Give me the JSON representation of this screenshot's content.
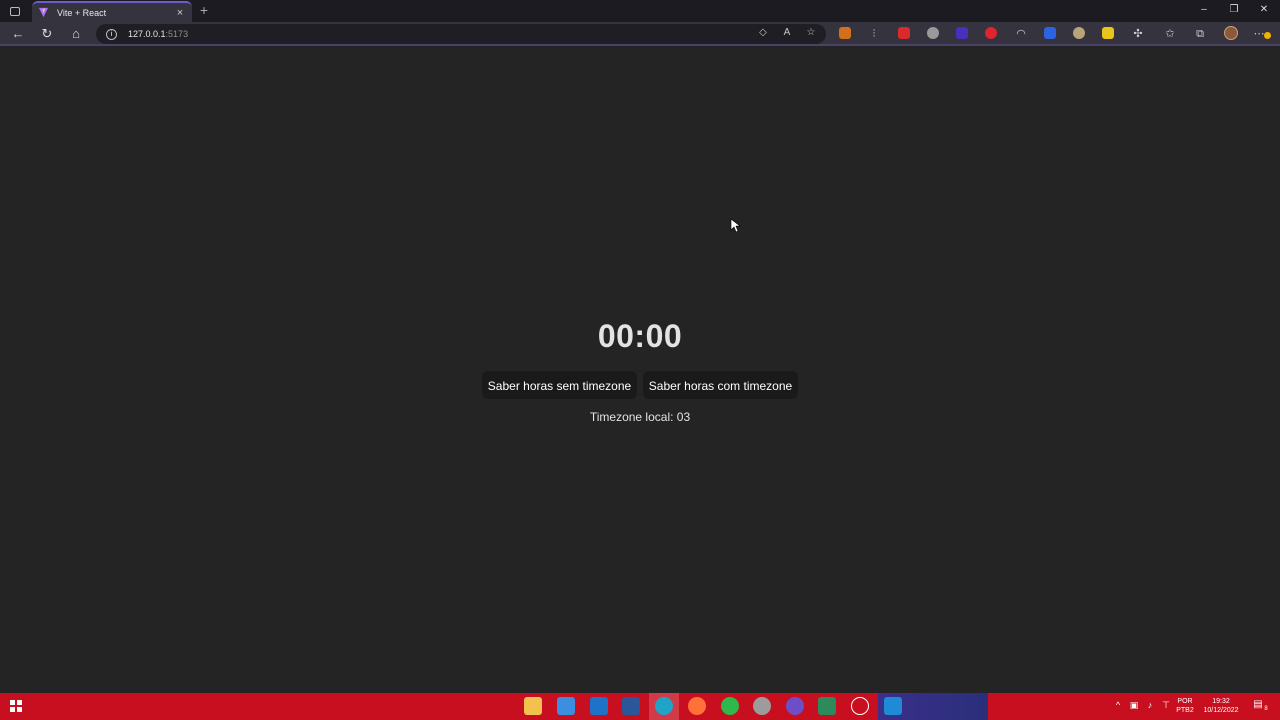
{
  "browser": {
    "tab_title": "Vite + React",
    "tab_close": "×",
    "new_tab": "+",
    "url_host": "127.0.0.1",
    "url_port": ":5173",
    "window_controls": {
      "minimize": "–",
      "restore": "❐",
      "close": "✕"
    }
  },
  "app": {
    "clock": "00:00",
    "button_without_tz": "Saber horas sem timezone",
    "button_with_tz": "Saber horas com timezone",
    "timezone_text": "Timezone local: 03"
  },
  "taskbar": {
    "language": "POR",
    "layout": "PTB2",
    "time": "19:32",
    "date": "10/12/2022",
    "notifications": "8"
  },
  "colors": {
    "page_bg": "#242424",
    "button_bg": "#1a1a1a",
    "taskbar": "#c70f1f",
    "tab_accent": "#6b5ec9"
  }
}
